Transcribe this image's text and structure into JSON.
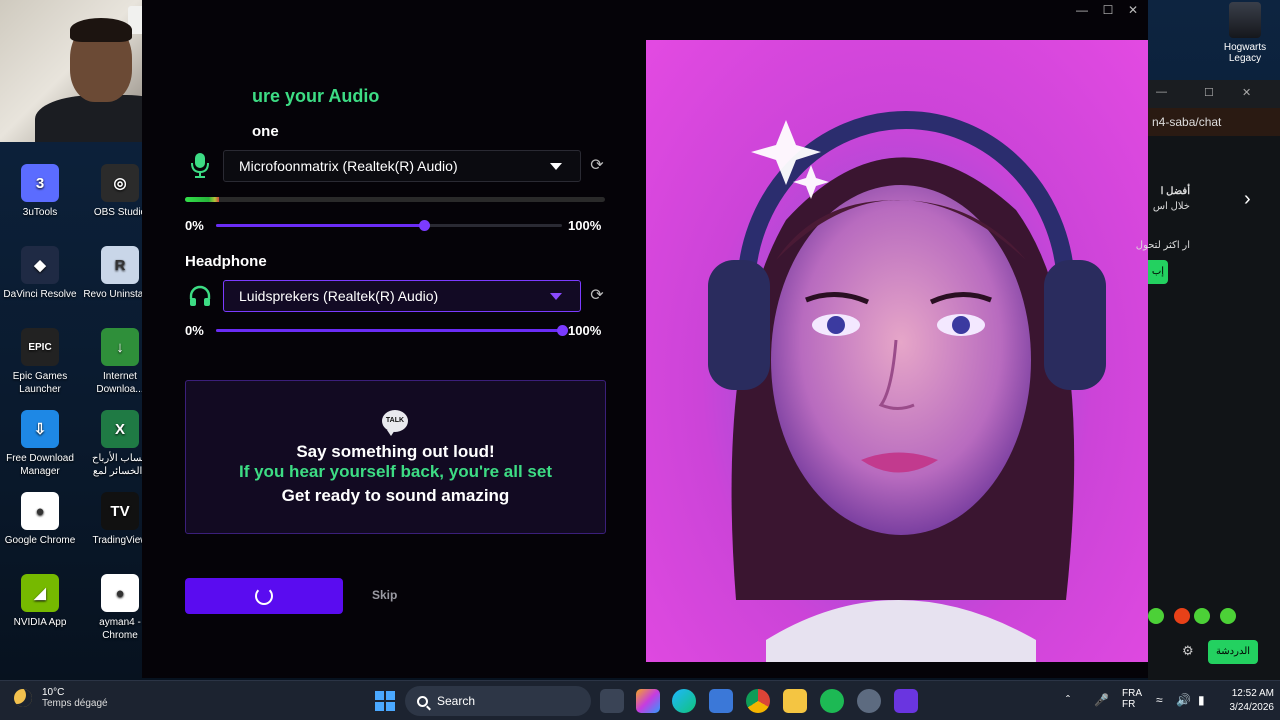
{
  "desktop": {
    "icons": [
      {
        "label": "3uTools",
        "glyph": "3",
        "color": "#5b6cff"
      },
      {
        "label": "OBS Studio",
        "glyph": "◎",
        "color": "#2b2b2b"
      },
      {
        "label": "DaVinci Resolve",
        "glyph": "◆",
        "color": "#1f2a44"
      },
      {
        "label": "Revo Uninstaller",
        "glyph": "R",
        "color": "#c9d6e8"
      },
      {
        "label": "Epic Games Launcher",
        "glyph": "EPIC",
        "color": "#222"
      },
      {
        "label": "Internet Downloa...",
        "glyph": "↓",
        "color": "#2f8f3a"
      },
      {
        "label": "Free Download Manager",
        "glyph": "⇩",
        "color": "#1e88e5"
      },
      {
        "label": "حساب الأرباح والخسائر لمع",
        "glyph": "X",
        "color": "#1f7a44"
      },
      {
        "label": "Google Chrome",
        "glyph": "●",
        "color": "#ffffff"
      },
      {
        "label": "TradingView",
        "glyph": "TV",
        "color": "#111"
      },
      {
        "label": "NVIDIA App",
        "glyph": "◢",
        "color": "#76b900"
      },
      {
        "label": "ayman4 - Chrome",
        "glyph": "●",
        "color": "#ffffff"
      }
    ],
    "hogwarts_label": "Hogwarts Legacy"
  },
  "app": {
    "title": "ure your Audio",
    "mic_heading": "one",
    "mic_device": "Microfoonmatrix (Realtek(R) Audio)",
    "mic_level": 0.08,
    "mic_volume": 0.6,
    "mic_min": "0%",
    "mic_max": "100%",
    "headphone_heading": "Headphone",
    "headphone_device": "Luidsprekers (Realtek(R) Audio)",
    "headphone_volume": 1.0,
    "hp_min": "0%",
    "hp_max": "100%",
    "talk_icon": "TALK",
    "line1": "Say something out loud!",
    "line2": "If you hear yourself back, you're all set",
    "line3": "Get ready to sound amazing",
    "skip_label": "Skip",
    "colors": {
      "accent": "#5a0cf0",
      "green": "#3ddc84"
    }
  },
  "browser": {
    "address": "n4-saba/chat",
    "ar1": "أفضل ا",
    "ar2": "خلال اس",
    "ar3": "ار اكثر لتحول",
    "pill": "إب",
    "chat_button": "الدردشة"
  },
  "taskbar": {
    "temp": "10°C",
    "weather": "Temps dégagé",
    "search_label": "Search",
    "lang1": "FRA",
    "lang2": "FR",
    "time": "12:52 AM",
    "date": "3/24/2026"
  }
}
